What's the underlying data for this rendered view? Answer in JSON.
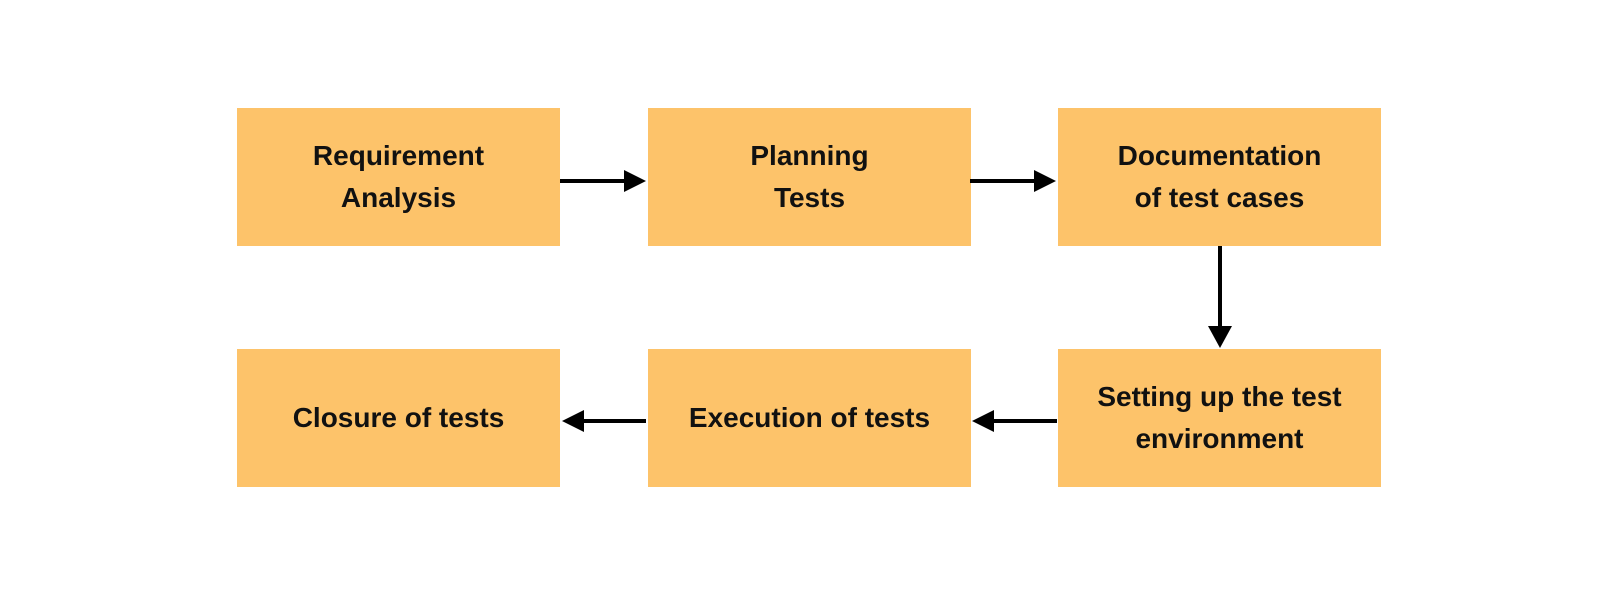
{
  "diagram": {
    "type": "flowchart",
    "title": "",
    "colors": {
      "node_fill": "#FDC36A",
      "text": "#111111",
      "arrow": "#000000",
      "background": "#FFFFFF"
    },
    "nodes": [
      {
        "id": "requirement-analysis",
        "label": "Requirement\nAnalysis"
      },
      {
        "id": "planning-tests",
        "label": "Planning\nTests"
      },
      {
        "id": "documentation-of-test-cases",
        "label": "Documentation\nof test cases"
      },
      {
        "id": "setting-up-test-environment",
        "label": "Setting up the test\nenvironment"
      },
      {
        "id": "execution-of-tests",
        "label": "Execution of tests"
      },
      {
        "id": "closure-of-tests",
        "label": "Closure of tests"
      }
    ],
    "edges": [
      {
        "from": "requirement-analysis",
        "to": "planning-tests"
      },
      {
        "from": "planning-tests",
        "to": "documentation-of-test-cases"
      },
      {
        "from": "documentation-of-test-cases",
        "to": "setting-up-test-environment"
      },
      {
        "from": "setting-up-test-environment",
        "to": "execution-of-tests"
      },
      {
        "from": "execution-of-tests",
        "to": "closure-of-tests"
      }
    ]
  }
}
